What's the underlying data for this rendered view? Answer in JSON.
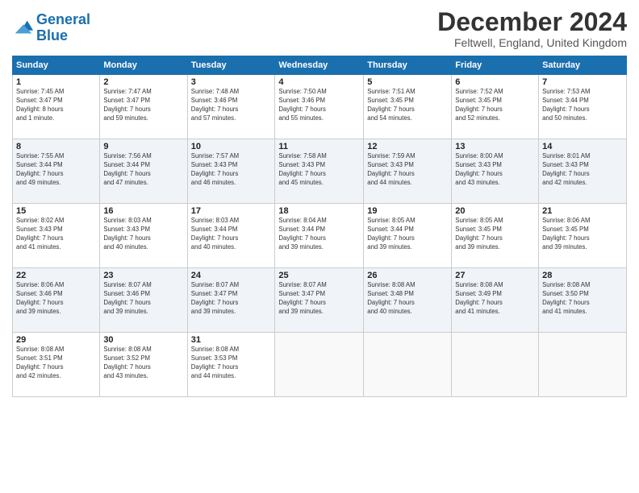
{
  "header": {
    "logo_line1": "General",
    "logo_line2": "Blue",
    "main_title": "December 2024",
    "subtitle": "Feltwell, England, United Kingdom"
  },
  "calendar": {
    "headers": [
      "Sunday",
      "Monday",
      "Tuesday",
      "Wednesday",
      "Thursday",
      "Friday",
      "Saturday"
    ],
    "weeks": [
      [
        null,
        {
          "day": "2",
          "sunrise": "7:47 AM",
          "sunset": "3:47 PM",
          "daylight": "7 hours and 59 minutes."
        },
        {
          "day": "3",
          "sunrise": "7:48 AM",
          "sunset": "3:46 PM",
          "daylight": "7 hours and 57 minutes."
        },
        {
          "day": "4",
          "sunrise": "7:50 AM",
          "sunset": "3:46 PM",
          "daylight": "7 hours and 55 minutes."
        },
        {
          "day": "5",
          "sunrise": "7:51 AM",
          "sunset": "3:45 PM",
          "daylight": "7 hours and 54 minutes."
        },
        {
          "day": "6",
          "sunrise": "7:52 AM",
          "sunset": "3:45 PM",
          "daylight": "7 hours and 52 minutes."
        },
        {
          "day": "7",
          "sunrise": "7:53 AM",
          "sunset": "3:44 PM",
          "daylight": "7 hours and 50 minutes."
        }
      ],
      [
        {
          "day": "1",
          "sunrise": "7:45 AM",
          "sunset": "3:47 PM",
          "daylight": "8 hours and 1 minute."
        },
        {
          "day": "8",
          "sunrise": "7:55 AM",
          "sunset": "3:44 PM",
          "daylight": "7 hours and 49 minutes."
        },
        {
          "day": "9",
          "sunrise": "7:56 AM",
          "sunset": "3:44 PM",
          "daylight": "7 hours and 47 minutes."
        },
        {
          "day": "10",
          "sunrise": "7:57 AM",
          "sunset": "3:43 PM",
          "daylight": "7 hours and 46 minutes."
        },
        {
          "day": "11",
          "sunrise": "7:58 AM",
          "sunset": "3:43 PM",
          "daylight": "7 hours and 45 minutes."
        },
        {
          "day": "12",
          "sunrise": "7:59 AM",
          "sunset": "3:43 PM",
          "daylight": "7 hours and 44 minutes."
        },
        {
          "day": "13",
          "sunrise": "8:00 AM",
          "sunset": "3:43 PM",
          "daylight": "7 hours and 43 minutes."
        },
        {
          "day": "14",
          "sunrise": "8:01 AM",
          "sunset": "3:43 PM",
          "daylight": "7 hours and 42 minutes."
        }
      ],
      [
        {
          "day": "15",
          "sunrise": "8:02 AM",
          "sunset": "3:43 PM",
          "daylight": "7 hours and 41 minutes."
        },
        {
          "day": "16",
          "sunrise": "8:03 AM",
          "sunset": "3:43 PM",
          "daylight": "7 hours and 40 minutes."
        },
        {
          "day": "17",
          "sunrise": "8:03 AM",
          "sunset": "3:44 PM",
          "daylight": "7 hours and 40 minutes."
        },
        {
          "day": "18",
          "sunrise": "8:04 AM",
          "sunset": "3:44 PM",
          "daylight": "7 hours and 39 minutes."
        },
        {
          "day": "19",
          "sunrise": "8:05 AM",
          "sunset": "3:44 PM",
          "daylight": "7 hours and 39 minutes."
        },
        {
          "day": "20",
          "sunrise": "8:05 AM",
          "sunset": "3:45 PM",
          "daylight": "7 hours and 39 minutes."
        },
        {
          "day": "21",
          "sunrise": "8:06 AM",
          "sunset": "3:45 PM",
          "daylight": "7 hours and 39 minutes."
        }
      ],
      [
        {
          "day": "22",
          "sunrise": "8:06 AM",
          "sunset": "3:46 PM",
          "daylight": "7 hours and 39 minutes."
        },
        {
          "day": "23",
          "sunrise": "8:07 AM",
          "sunset": "3:46 PM",
          "daylight": "7 hours and 39 minutes."
        },
        {
          "day": "24",
          "sunrise": "8:07 AM",
          "sunset": "3:47 PM",
          "daylight": "7 hours and 39 minutes."
        },
        {
          "day": "25",
          "sunrise": "8:07 AM",
          "sunset": "3:47 PM",
          "daylight": "7 hours and 39 minutes."
        },
        {
          "day": "26",
          "sunrise": "8:08 AM",
          "sunset": "3:48 PM",
          "daylight": "7 hours and 40 minutes."
        },
        {
          "day": "27",
          "sunrise": "8:08 AM",
          "sunset": "3:49 PM",
          "daylight": "7 hours and 41 minutes."
        },
        {
          "day": "28",
          "sunrise": "8:08 AM",
          "sunset": "3:50 PM",
          "daylight": "7 hours and 41 minutes."
        }
      ],
      [
        {
          "day": "29",
          "sunrise": "8:08 AM",
          "sunset": "3:51 PM",
          "daylight": "7 hours and 42 minutes."
        },
        {
          "day": "30",
          "sunrise": "8:08 AM",
          "sunset": "3:52 PM",
          "daylight": "7 hours and 43 minutes."
        },
        {
          "day": "31",
          "sunrise": "8:08 AM",
          "sunset": "3:53 PM",
          "daylight": "7 hours and 44 minutes."
        },
        null,
        null,
        null,
        null
      ]
    ]
  },
  "labels": {
    "sunrise_prefix": "Sunrise: ",
    "sunset_prefix": "Sunset: ",
    "daylight_prefix": "Daylight: "
  }
}
